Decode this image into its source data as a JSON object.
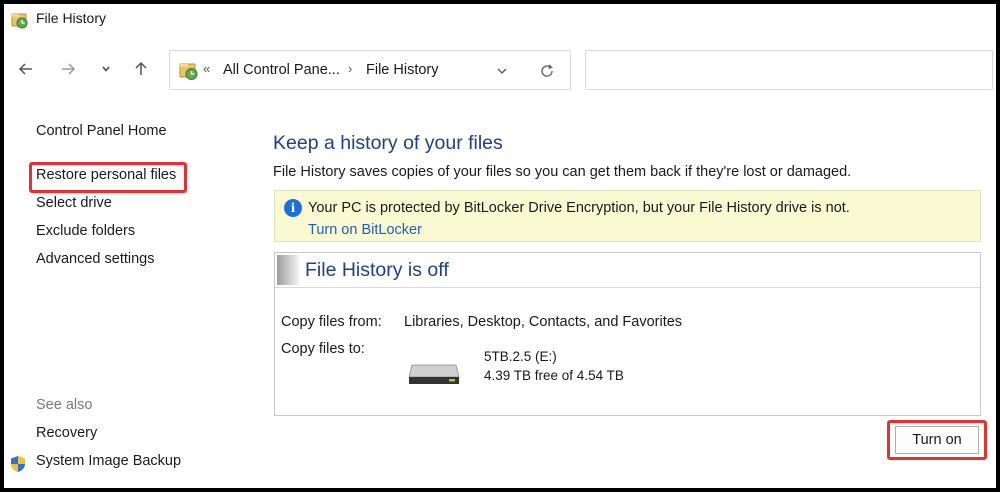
{
  "window": {
    "title": "File History"
  },
  "navbar": {
    "back_icon": "arrow-left-icon",
    "forward_icon": "arrow-right-icon",
    "recent_icon": "chevron-down-icon",
    "up_icon": "arrow-up-icon",
    "address": {
      "overflow_chevron": "«",
      "crumbs": [
        "All Control Pane...",
        "File History"
      ],
      "separator": "›"
    },
    "search_placeholder": ""
  },
  "sidebar": {
    "items": [
      {
        "label": "Control Panel Home"
      },
      {
        "label": "Restore personal files",
        "highlighted": true
      },
      {
        "label": "Select drive"
      },
      {
        "label": "Exclude folders"
      },
      {
        "label": "Advanced settings"
      }
    ],
    "see_also": {
      "heading": "See also",
      "items": [
        {
          "label": "Recovery"
        },
        {
          "label": "System Image Backup",
          "icon": "shield-icon"
        }
      ]
    }
  },
  "main": {
    "title": "Keep a history of your files",
    "description": "File History saves copies of your files so you can get them back if they're lost or damaged.",
    "info": {
      "icon": "info-icon",
      "text": "Your PC is protected by BitLocker Drive Encryption, but your File History drive is not.",
      "link": "Turn on BitLocker"
    },
    "status": {
      "title": "File History is off",
      "copy_from_label": "Copy files from:",
      "copy_from_value": "Libraries, Desktop, Contacts, and Favorites",
      "copy_to_label": "Copy files to:",
      "drive_name": "5TB.2.5 (E:)",
      "drive_free": "4.39 TB free of 4.54 TB"
    },
    "turn_on_label": "Turn on"
  },
  "colors": {
    "heading_blue": "#1f3f8f",
    "link_blue": "#1f5fb0",
    "highlight_red": "#e8312f",
    "info_background": "#fafad2"
  }
}
